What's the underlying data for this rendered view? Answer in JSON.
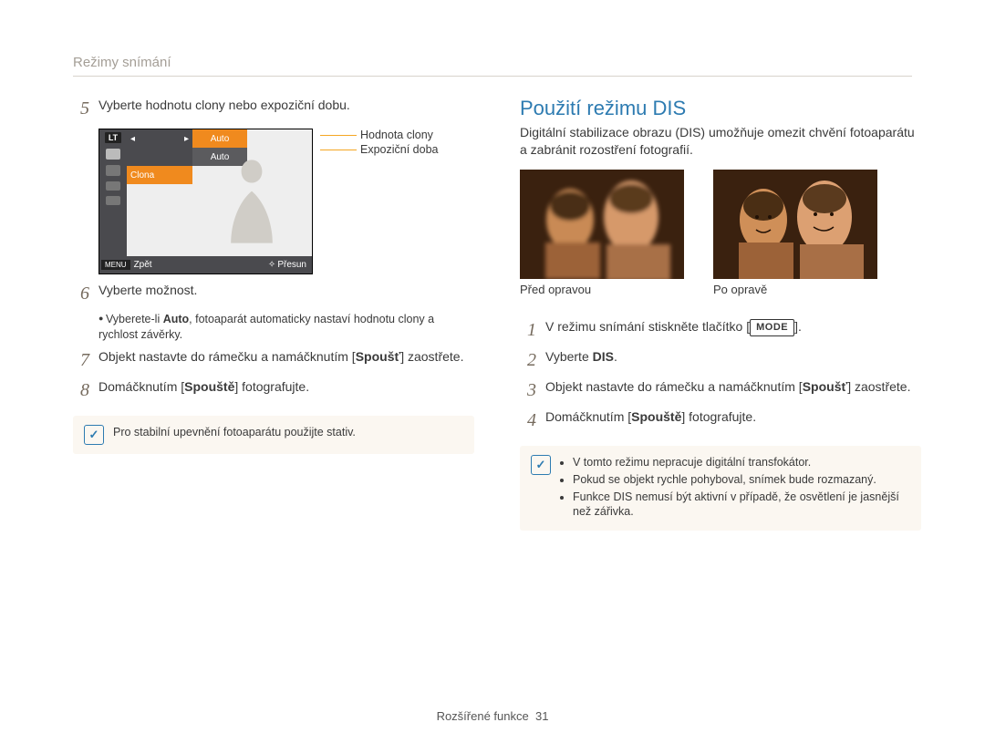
{
  "breadcrumb": "Režimy snímání",
  "left": {
    "step5": {
      "num": "5",
      "text": "Vyberte hodnotu clony nebo expoziční dobu."
    },
    "camera": {
      "lt": "LT",
      "row1_right": "Auto",
      "row2_right": "Auto",
      "row_sel": "Clona",
      "foot_menu": "MENU",
      "foot_back": "Zpět",
      "foot_nav": "Přesun"
    },
    "callout1": "Hodnota clony",
    "callout2": "Expoziční doba",
    "step6": {
      "num": "6",
      "text": "Vyberte možnost."
    },
    "step6_sub_a": "Vyberete-li ",
    "step6_sub_b": "Auto",
    "step6_sub_c": ", fotoaparát automaticky nastaví hodnotu clony a rychlost závěrky.",
    "step7": {
      "num": "7",
      "a": "Objekt nastavte do rámečku a namáčknutím [",
      "b": "Spoušť",
      "c": "] zaostřete."
    },
    "step8": {
      "num": "8",
      "a": "Domáčknutím [",
      "b": "Spouště",
      "c": "] fotografujte."
    },
    "note": "Pro stabilní upevnění fotoaparátu použijte stativ."
  },
  "right": {
    "heading": "Použití režimu DIS",
    "lead": "Digitální stabilizace obrazu (DIS) umožňuje omezit chvění fotoaparátu a zabránit rozostření fotografií.",
    "caption_before": "Před opravou",
    "caption_after": "Po opravě",
    "step1": {
      "num": "1",
      "a": "V režimu snímání stiskněte tlačítko [",
      "mode": "MODE",
      "b": "]."
    },
    "step2": {
      "num": "2",
      "a": "Vyberte ",
      "b": "DIS",
      "c": "."
    },
    "step3": {
      "num": "3",
      "a": "Objekt nastavte do rámečku a namáčknutím [",
      "b": "Spoušť",
      "c": "] zaostřete."
    },
    "step4": {
      "num": "4",
      "a": "Domáčknutím [",
      "b": "Spouště",
      "c": "] fotografujte."
    },
    "note_items": [
      "V tomto režimu nepracuje digitální transfokátor.",
      "Pokud se objekt rychle pohyboval, snímek bude rozmazaný.",
      "Funkce DIS nemusí být aktivní v případě, že osvětlení je jasnější než zářivka."
    ]
  },
  "footer": {
    "section": "Rozšířené funkce",
    "page": "31"
  }
}
